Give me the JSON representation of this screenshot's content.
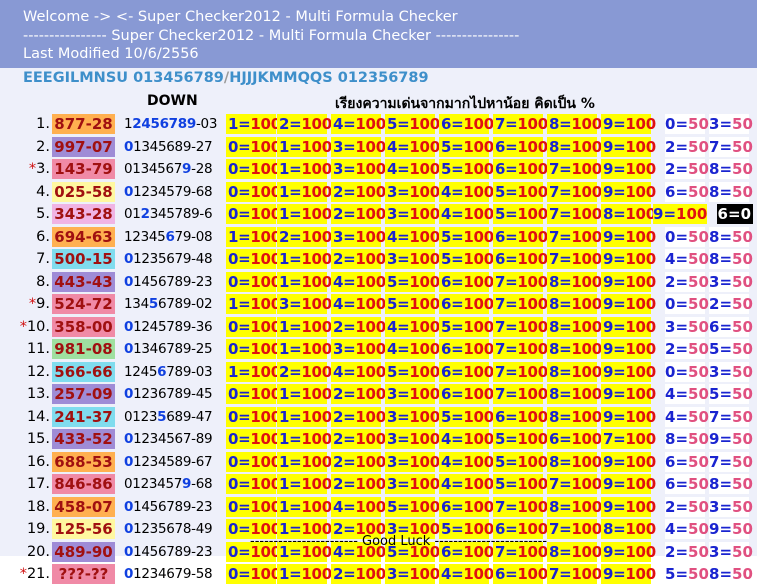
{
  "header": {
    "line1": "Welcome -> <- Super Checker2012 - Multi Formula Checker",
    "line2": "---------------- Super Checker2012 - Multi Formula Checker ----------------",
    "line3": "Last Modified 10/6/2556"
  },
  "code_line": "EEEGILMNSU 013456789 HJJJKMMQQS 012356789",
  "code_separator": "/",
  "col_down": "DOWN",
  "col_thai": "เรียงความเด่นจากมากไปหาน้อย คิดเป็น %",
  "footer": "----------------------- Good Luck ------------------------",
  "colors": {
    "pair_bg": [
      "#ffb050",
      "#9f8cd6",
      "#f08aa6",
      "#fff8a0",
      "#f0b4e4",
      "#ffb050",
      "#80dcee",
      "#9f8cd6",
      "#f08aa6",
      "#f08aa6",
      "#9fe0a0",
      "#80dcee",
      "#9f8cd6",
      "#80dcee",
      "#9f8cd6",
      "#ffb050",
      "#f08aa6",
      "#ffb050",
      "#fff8a0",
      "#9f8cd6",
      "#f08aa6"
    ]
  },
  "rows": [
    {
      "num": "1.",
      "star": "",
      "pair": "877-28",
      "dpre": "1",
      "dhl": "2456789",
      "dpost": "-03",
      "f": [
        "1=100",
        "2=100",
        "4=100",
        "5=100",
        "6=100",
        "7=100",
        "8=100",
        "9=100"
      ],
      "t": [
        "0=50",
        "3=50"
      ]
    },
    {
      "num": "2.",
      "star": "",
      "pair": "997-07",
      "dpre": "",
      "dhl": "0",
      "dpost": "1345689-27",
      "f": [
        "0=100",
        "1=100",
        "3=100",
        "4=100",
        "5=100",
        "6=100",
        "8=100",
        "9=100"
      ],
      "t": [
        "2=50",
        "7=50"
      ]
    },
    {
      "num": "3.",
      "star": "*",
      "pair": "143-79",
      "dpre": "0134567",
      "dhl": "9",
      "dpost": "-28",
      "f": [
        "0=100",
        "1=100",
        "3=100",
        "4=100",
        "5=100",
        "6=100",
        "7=100",
        "9=100"
      ],
      "t": [
        "2=50",
        "8=50"
      ]
    },
    {
      "num": "4.",
      "star": "",
      "pair": "025-58",
      "dpre": "",
      "dhl": "0",
      "dpost": "1234579-68",
      "f": [
        "0=100",
        "1=100",
        "2=100",
        "3=100",
        "4=100",
        "5=100",
        "7=100",
        "9=100"
      ],
      "t": [
        "6=50",
        "8=50"
      ]
    },
    {
      "num": "5.",
      "star": "",
      "pair": "343-28",
      "dpre": "01",
      "dhl": "2",
      "dpost": "345789-6",
      "f": [
        "0=100",
        "1=100",
        "2=100",
        "3=100",
        "4=100",
        "5=100",
        "7=100",
        "8=100"
      ],
      "t": [
        "9=100",
        "6=0"
      ]
    },
    {
      "num": "6.",
      "star": "",
      "pair": "694-63",
      "dpre": "12345",
      "dhl": "6",
      "dpost": "79-08",
      "f": [
        "1=100",
        "2=100",
        "3=100",
        "4=100",
        "5=100",
        "6=100",
        "7=100",
        "9=100"
      ],
      "t": [
        "0=50",
        "8=50"
      ]
    },
    {
      "num": "7.",
      "star": "",
      "pair": "500-15",
      "dpre": "",
      "dhl": "0",
      "dpost": "1235679-48",
      "f": [
        "0=100",
        "1=100",
        "2=100",
        "3=100",
        "5=100",
        "6=100",
        "7=100",
        "9=100"
      ],
      "t": [
        "4=50",
        "8=50"
      ]
    },
    {
      "num": "8.",
      "star": "",
      "pair": "443-43",
      "dpre": "",
      "dhl": "0",
      "dpost": "1456789-23",
      "f": [
        "0=100",
        "1=100",
        "4=100",
        "5=100",
        "6=100",
        "7=100",
        "8=100",
        "9=100"
      ],
      "t": [
        "2=50",
        "3=50"
      ]
    },
    {
      "num": "9.",
      "star": "*",
      "pair": "524-72",
      "dpre": "134",
      "dhl": "5",
      "dpost": "6789-02",
      "f": [
        "1=100",
        "3=100",
        "4=100",
        "5=100",
        "6=100",
        "7=100",
        "8=100",
        "9=100"
      ],
      "t": [
        "0=50",
        "2=50"
      ]
    },
    {
      "num": "10.",
      "star": "*",
      "pair": "358-00",
      "dpre": "",
      "dhl": "0",
      "dpost": "1245789-36",
      "f": [
        "0=100",
        "1=100",
        "2=100",
        "4=100",
        "5=100",
        "7=100",
        "8=100",
        "9=100"
      ],
      "t": [
        "3=50",
        "6=50"
      ]
    },
    {
      "num": "11.",
      "star": "",
      "pair": "981-08",
      "dpre": "",
      "dhl": "0",
      "dpost": "1346789-25",
      "f": [
        "0=100",
        "1=100",
        "3=100",
        "4=100",
        "6=100",
        "7=100",
        "8=100",
        "9=100"
      ],
      "t": [
        "2=50",
        "5=50"
      ]
    },
    {
      "num": "12.",
      "star": "",
      "pair": "566-66",
      "dpre": "1245",
      "dhl": "6",
      "dpost": "789-03",
      "f": [
        "1=100",
        "2=100",
        "4=100",
        "5=100",
        "6=100",
        "7=100",
        "8=100",
        "9=100"
      ],
      "t": [
        "0=50",
        "3=50"
      ]
    },
    {
      "num": "13.",
      "star": "",
      "pair": "257-09",
      "dpre": "",
      "dhl": "0",
      "dpost": "1236789-45",
      "f": [
        "0=100",
        "1=100",
        "2=100",
        "3=100",
        "6=100",
        "7=100",
        "8=100",
        "9=100"
      ],
      "t": [
        "4=50",
        "5=50"
      ]
    },
    {
      "num": "14.",
      "star": "",
      "pair": "241-37",
      "dpre": "0123",
      "dhl": "5",
      "dpost": "689-47",
      "f": [
        "0=100",
        "1=100",
        "2=100",
        "3=100",
        "5=100",
        "6=100",
        "8=100",
        "9=100"
      ],
      "t": [
        "4=50",
        "7=50"
      ]
    },
    {
      "num": "15.",
      "star": "",
      "pair": "433-52",
      "dpre": "",
      "dhl": "0",
      "dpost": "1234567-89",
      "f": [
        "0=100",
        "1=100",
        "2=100",
        "3=100",
        "4=100",
        "5=100",
        "6=100",
        "7=100"
      ],
      "t": [
        "8=50",
        "9=50"
      ]
    },
    {
      "num": "16.",
      "star": "",
      "pair": "688-53",
      "dpre": "",
      "dhl": "0",
      "dpost": "1234589-67",
      "f": [
        "0=100",
        "1=100",
        "2=100",
        "3=100",
        "4=100",
        "5=100",
        "8=100",
        "9=100"
      ],
      "t": [
        "6=50",
        "7=50"
      ]
    },
    {
      "num": "17.",
      "star": "",
      "pair": "846-86",
      "dpre": "0123457",
      "dhl": "9",
      "dpost": "-68",
      "f": [
        "0=100",
        "1=100",
        "2=100",
        "3=100",
        "4=100",
        "5=100",
        "7=100",
        "9=100"
      ],
      "t": [
        "6=50",
        "8=50"
      ]
    },
    {
      "num": "18.",
      "star": "",
      "pair": "458-07",
      "dpre": "",
      "dhl": "0",
      "dpost": "1456789-23",
      "f": [
        "0=100",
        "1=100",
        "4=100",
        "5=100",
        "6=100",
        "7=100",
        "8=100",
        "9=100"
      ],
      "t": [
        "2=50",
        "3=50"
      ]
    },
    {
      "num": "19.",
      "star": "",
      "pair": "125-56",
      "dpre": "",
      "dhl": "0",
      "dpost": "1235678-49",
      "f": [
        "0=100",
        "1=100",
        "2=100",
        "3=100",
        "5=100",
        "6=100",
        "7=100",
        "8=100"
      ],
      "t": [
        "4=50",
        "9=50"
      ]
    },
    {
      "num": "20.",
      "star": "",
      "pair": "489-90",
      "dpre": "",
      "dhl": "0",
      "dpost": "1456789-23",
      "f": [
        "0=100",
        "1=100",
        "4=100",
        "5=100",
        "6=100",
        "7=100",
        "8=100",
        "9=100"
      ],
      "t": [
        "2=50",
        "3=50"
      ]
    },
    {
      "num": "21.",
      "star": "*",
      "pair": "???-??",
      "dpre": "",
      "dhl": "0",
      "dpost": "1234679-58",
      "f": [
        "0=100",
        "1=100",
        "2=100",
        "3=100",
        "4=100",
        "6=100",
        "7=100",
        "9=100"
      ],
      "t": [
        "5=50",
        "8=50"
      ]
    }
  ]
}
